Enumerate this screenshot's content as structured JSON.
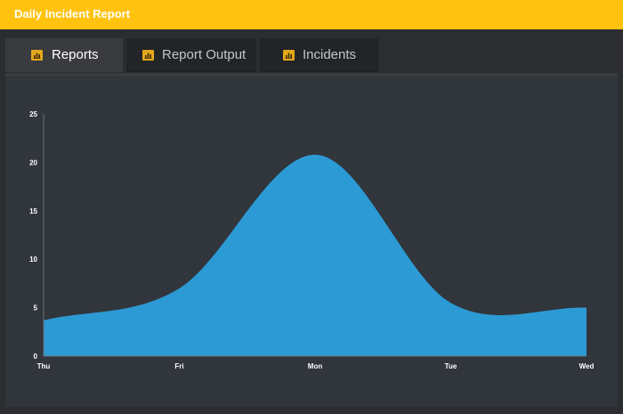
{
  "header": {
    "title": "Daily Incident Report",
    "bar_color": "#ffc20e"
  },
  "tabs": [
    {
      "label": "Reports",
      "active": true,
      "icon": "bar-chart-icon"
    },
    {
      "label": "Report Output",
      "active": false,
      "icon": "bar-chart-icon"
    },
    {
      "label": "Incidents",
      "active": false,
      "icon": "bar-chart-icon"
    }
  ],
  "chart_data": {
    "type": "area",
    "categories": [
      "Thu",
      "Fri",
      "Mon",
      "Tue",
      "Wed"
    ],
    "values": [
      3.7,
      7,
      20.8,
      5.5,
      5
    ],
    "ylim": [
      0,
      25
    ],
    "yticks": [
      "0",
      "5",
      "10",
      "15",
      "20",
      "25"
    ],
    "xlabel": "",
    "ylabel": "",
    "grid": false,
    "legend": "none",
    "fill_color": "#2c9ad4"
  }
}
